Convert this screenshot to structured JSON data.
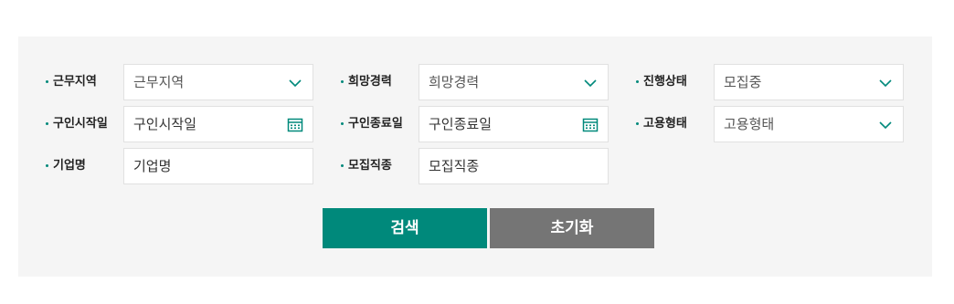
{
  "filters": {
    "work_region": {
      "label": "근무지역",
      "value": "근무지역"
    },
    "desired_career": {
      "label": "희망경력",
      "value": "희망경력"
    },
    "progress_status": {
      "label": "진행상태",
      "value": "모집중"
    },
    "recruit_start": {
      "label": "구인시작일",
      "value": "구인시작일"
    },
    "recruit_end": {
      "label": "구인종료일",
      "value": "구인종료일"
    },
    "employment_type": {
      "label": "고용형태",
      "value": "고용형태"
    },
    "company_name": {
      "label": "기업명",
      "value": "기업명"
    },
    "job_type": {
      "label": "모집직종",
      "value": "모집직종"
    }
  },
  "buttons": {
    "search": "검색",
    "reset": "초기화"
  },
  "colors": {
    "accent": "#00897b",
    "reset": "#757575",
    "panel": "#f5f5f5"
  }
}
